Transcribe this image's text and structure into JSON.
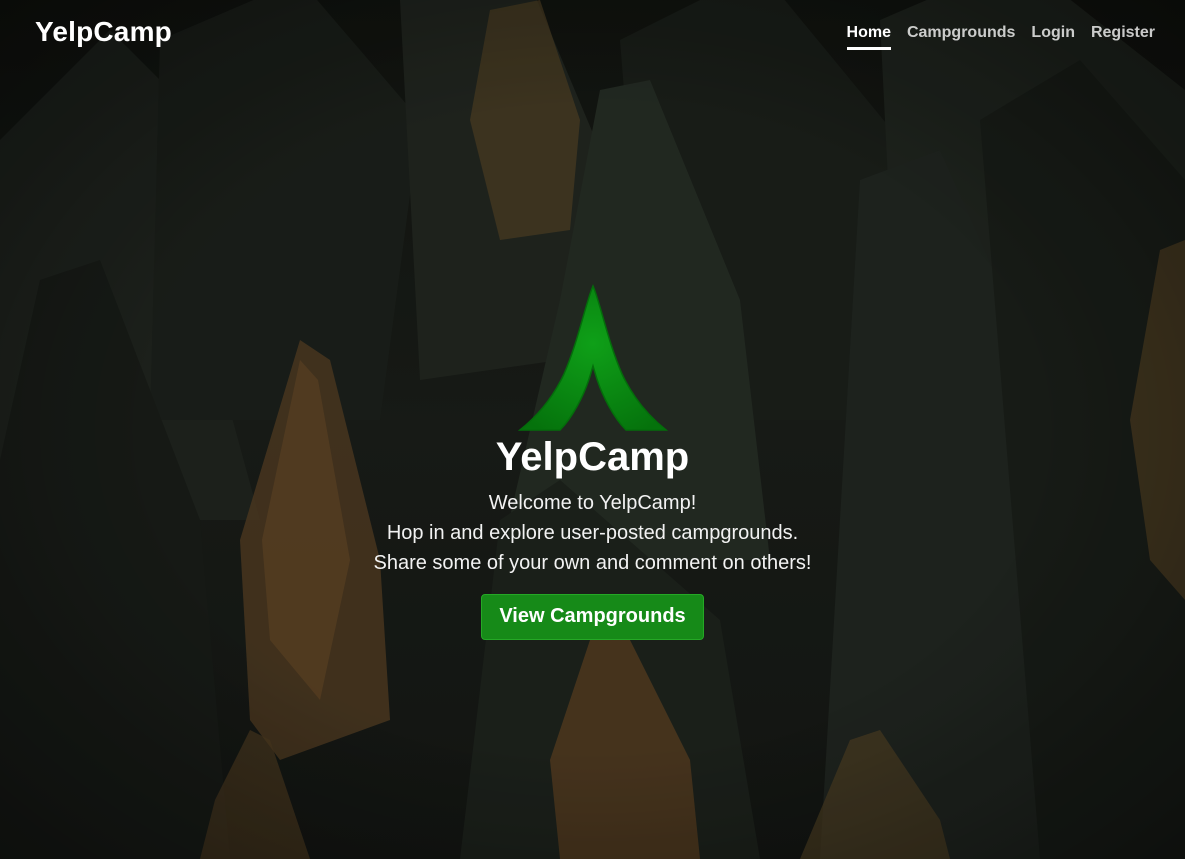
{
  "header": {
    "brand": "YelpCamp",
    "nav": [
      {
        "label": "Home",
        "active": true
      },
      {
        "label": "Campgrounds",
        "active": false
      },
      {
        "label": "Login",
        "active": false
      },
      {
        "label": "Register",
        "active": false
      }
    ]
  },
  "hero": {
    "logo_icon": "tent-icon",
    "title": "YelpCamp",
    "lines": [
      "Welcome to YelpCamp!",
      "Hop in and explore user-posted campgrounds.",
      "Share some of your own and comment on others!"
    ],
    "button_label": "View Campgrounds"
  },
  "colors": {
    "accent": "#168a18",
    "tent": "#0b8f14",
    "background": "#202420",
    "text": "#ffffff"
  }
}
